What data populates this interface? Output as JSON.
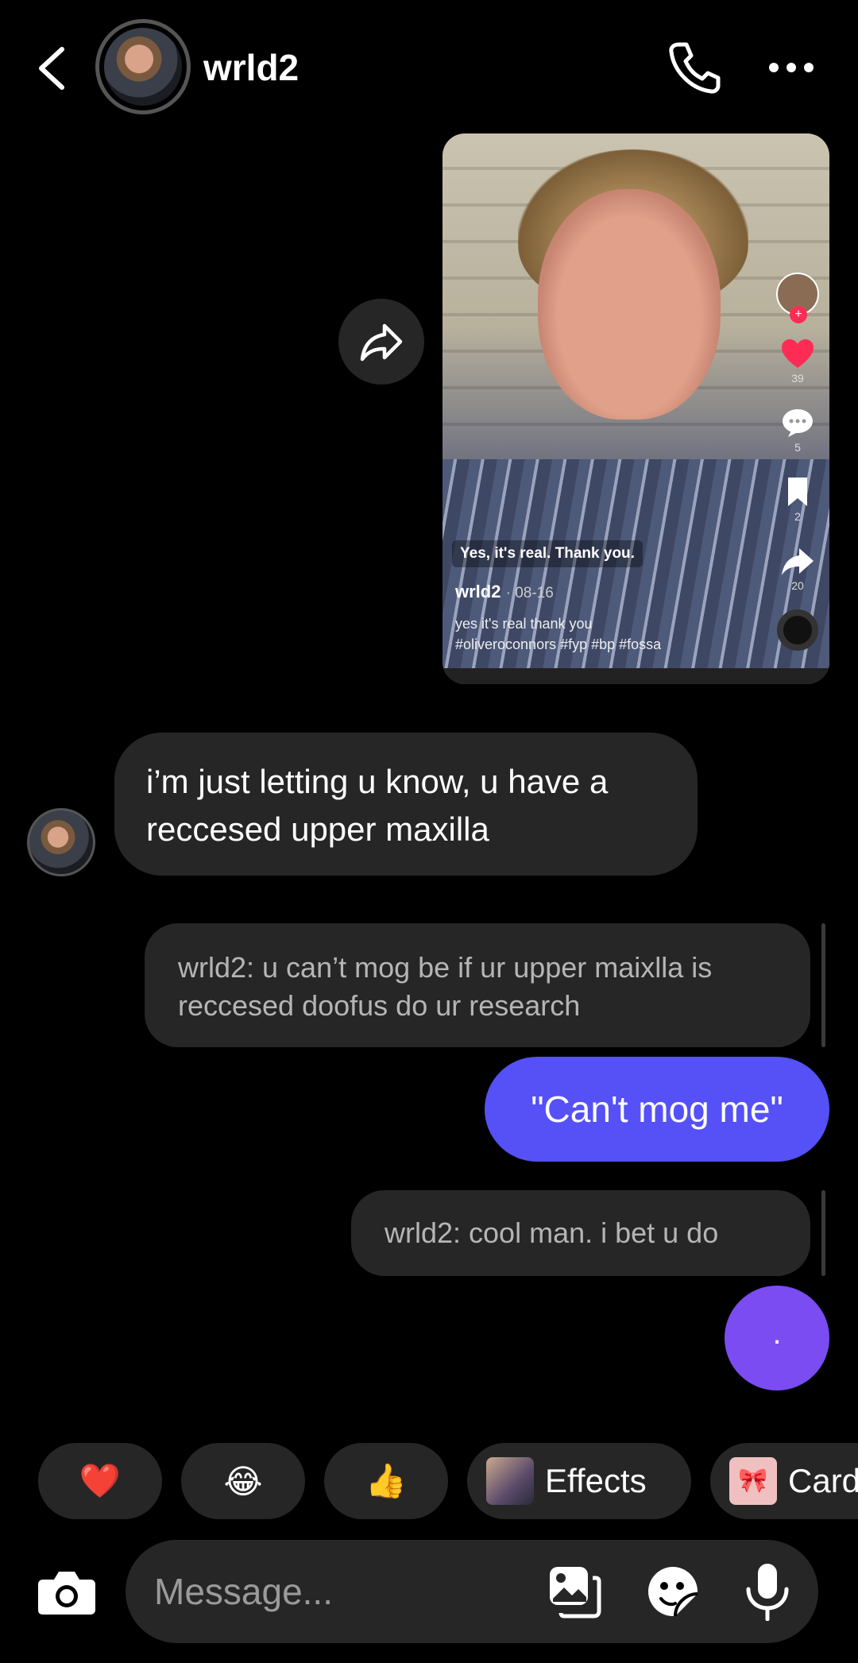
{
  "header": {
    "username": "wrld2"
  },
  "video_post": {
    "caption_chip": "Yes, it's real. Thank you.",
    "username": "wrld2",
    "date": "· 08-16",
    "description_line1": "yes it's real thank you",
    "description_line2": "#oliveroconnors #fyp #bp #fossa",
    "likes": "39",
    "comments": "5",
    "saves": "2",
    "shares": "20"
  },
  "messages": {
    "incoming_1": "i’m just letting u know, u have a reccesed upper maxilla",
    "reply_1": "wrld2: u can’t mog be if ur upper maixlla is reccesed doofus do ur research",
    "outgoing_1": "\"Can't mog me\"",
    "reply_2": "wrld2: cool man. i bet u do",
    "outgoing_2": "."
  },
  "quick_reactions": {
    "emoji_1": "❤️",
    "emoji_2": "😂",
    "emoji_3": "👍",
    "effects_label": "Effects",
    "cards_label": "Card"
  },
  "composer": {
    "placeholder": "Message..."
  },
  "colors": {
    "background": "#000000",
    "outgoing_bubble": "#5551f7",
    "dot_bubble": "#7b4cf2",
    "incoming_bubble": "#262626"
  }
}
